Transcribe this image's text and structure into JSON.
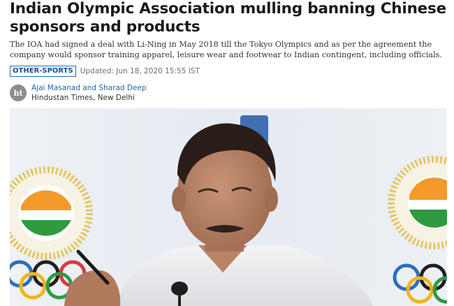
{
  "article": {
    "headline": "Indian Olympic Association mulling banning Chinese sponsors and products",
    "summary": "The IOA had signed a deal with Li-Ning in May 2018 till the Tokyo Olympics and as per the agreement the company would sponsor training apparel, leisure wear and footwear to Indian contingent, including officials.",
    "section_tag": "OTHER-SPORTS",
    "updated": "Updated: Jun 18, 2020 15:55 IST",
    "authors": "Ajai Masanad and Sharad Deep",
    "publication": "Hindustan Times, New Delhi",
    "avatar_text": "ht"
  },
  "colors": {
    "tag_border": "#1a6fb5",
    "author_link": "#2266aa",
    "headline": "#1a1a1a"
  },
  "icons": {
    "avatar": "ht-logo-icon"
  }
}
